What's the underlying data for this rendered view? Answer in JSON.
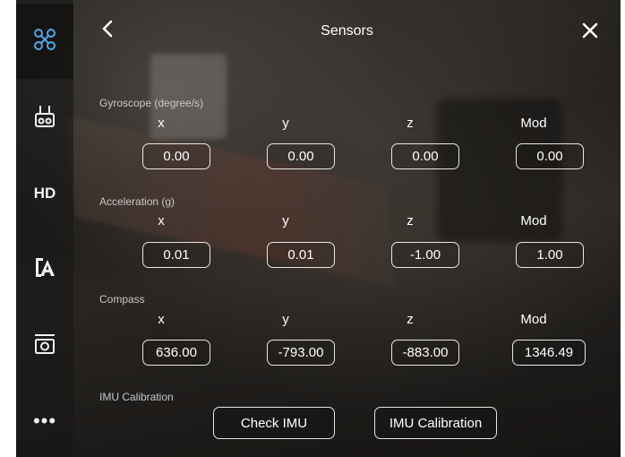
{
  "header": {
    "title": "Sensors"
  },
  "sidebar": {
    "items": [
      {
        "name": "aircraft",
        "icon": "drone-icon"
      },
      {
        "name": "remote-controller",
        "icon": "remote-controller-icon"
      },
      {
        "name": "hd",
        "label": "HD"
      },
      {
        "name": "visual-navigation",
        "icon": "visual-navigation-icon"
      },
      {
        "name": "camera",
        "icon": "camera-icon"
      },
      {
        "name": "more",
        "label": "•••"
      }
    ]
  },
  "sensors": {
    "gyroscope": {
      "label": "Gyroscope (degree/s)",
      "columns": [
        "x",
        "y",
        "z",
        "Mod"
      ],
      "values": [
        "0.00",
        "0.00",
        "0.00",
        "0.00"
      ]
    },
    "acceleration": {
      "label": "Acceleration (g)",
      "columns": [
        "x",
        "y",
        "z",
        "Mod"
      ],
      "values": [
        "0.01",
        "0.01",
        "-1.00",
        "1.00"
      ]
    },
    "compass": {
      "label": "Compass",
      "columns": [
        "x",
        "y",
        "z",
        "Mod"
      ],
      "values": [
        "636.00",
        "-793.00",
        "-883.00",
        "1346.49"
      ]
    }
  },
  "imu": {
    "label": "IMU Calibration",
    "check_button": "Check IMU",
    "calibration_button": "IMU Calibration"
  },
  "colors": {
    "text": "#ffffff",
    "muted": "#c8c8c8",
    "accent_icon": "#4ea9e6"
  }
}
